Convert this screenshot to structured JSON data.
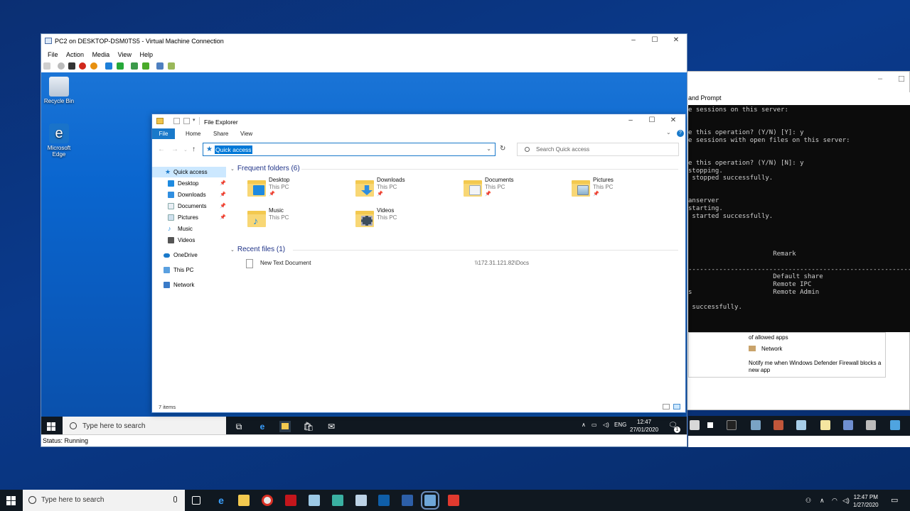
{
  "host": {
    "search_placeholder": "Type here to search",
    "clock_time": "12:47 PM",
    "clock_date": "1/27/2020"
  },
  "cmd": {
    "title": "and Prompt",
    "lines": [
      "e sessions on this server:",
      "",
      "",
      "e this operation? (Y/N) [Y]: y",
      "e sessions with open files on this server:",
      "",
      "",
      "e this operation? (Y/N) [N]: y",
      "stopping.",
      " stopped successfully.",
      "",
      "",
      "anserver",
      "starting.",
      " started successfully.",
      "",
      "",
      "",
      "",
      "                      Remark",
      "",
      "------------------------------------------------------------",
      "                      Default share",
      "                      Remote IPC",
      "s                     Remote Admin",
      "",
      " successfully."
    ],
    "firewall_line1": "of allowed apps",
    "firewall_network": "Network",
    "firewall_notify": "Notify me when Windows Defender Firewall blocks a new app"
  },
  "vm": {
    "title": "PC2 on DESKTOP-DSM0TS5 - Virtual Machine Connection",
    "menu": [
      "File",
      "Action",
      "Media",
      "View",
      "Help"
    ],
    "status": "Status: Running",
    "minimize": "–",
    "maximize": "☐",
    "close": "✕"
  },
  "guest": {
    "desktop_icons": [
      {
        "label": "Recycle Bin"
      },
      {
        "label": "Microsoft Edge"
      }
    ],
    "search_placeholder": "Type here to search",
    "tray_lang": "ENG",
    "clock_time": "12:47",
    "clock_date": "27/01/2020",
    "notif_count": "1"
  },
  "explorer": {
    "title": "File Explorer",
    "ribbon": {
      "file": "File",
      "home": "Home",
      "share": "Share",
      "view": "View"
    },
    "address": "Quick access",
    "search_placeholder": "Search Quick access",
    "nav": [
      {
        "label": "Quick access",
        "pinned": false
      },
      {
        "label": "Desktop",
        "pinned": true
      },
      {
        "label": "Downloads",
        "pinned": true
      },
      {
        "label": "Documents",
        "pinned": true
      },
      {
        "label": "Pictures",
        "pinned": true
      },
      {
        "label": "Music",
        "pinned": false
      },
      {
        "label": "Videos",
        "pinned": false
      },
      {
        "label": "OneDrive",
        "pinned": false
      },
      {
        "label": "This PC",
        "pinned": false
      },
      {
        "label": "Network",
        "pinned": false
      }
    ],
    "frequent_header": "Frequent folders (6)",
    "frequent": [
      {
        "name": "Desktop",
        "location": "This PC"
      },
      {
        "name": "Downloads",
        "location": "This PC"
      },
      {
        "name": "Documents",
        "location": "This PC"
      },
      {
        "name": "Pictures",
        "location": "This PC"
      },
      {
        "name": "Music",
        "location": "This PC"
      },
      {
        "name": "Videos",
        "location": "This PC"
      }
    ],
    "recent_header": "Recent files (1)",
    "recent": [
      {
        "name": "New Text Document",
        "path": "\\\\172.31.121.82\\Docs"
      }
    ],
    "status": "7 items"
  }
}
